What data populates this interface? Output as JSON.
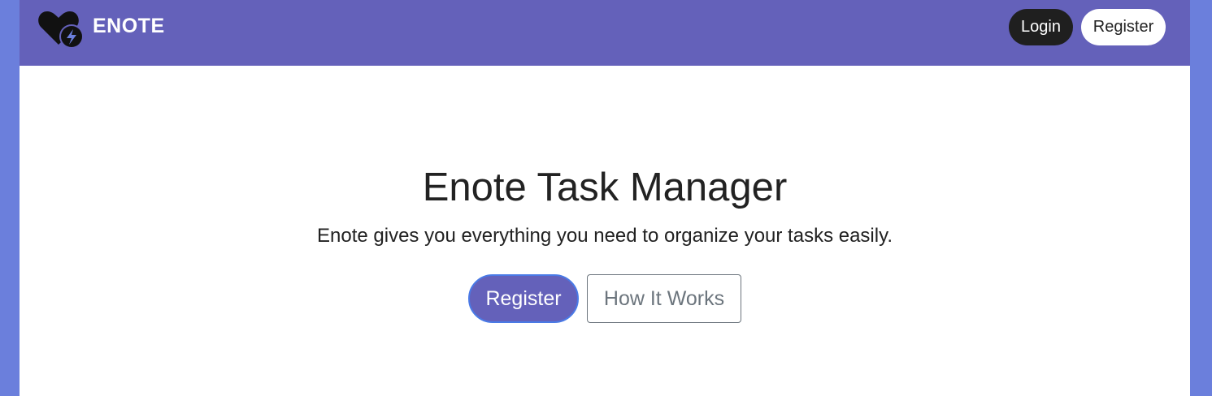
{
  "navbar": {
    "brand_name": "ENOTE",
    "login_label": "Login",
    "register_label": "Register"
  },
  "hero": {
    "title": "Enote Task Manager",
    "subtitle": "Enote gives you everything you need to organize your tasks easily.",
    "primary_button": "Register",
    "secondary_button": "How It Works"
  },
  "colors": {
    "navbar_bg": "#6461ba",
    "outer_bg": "#6b7fdc",
    "login_bg": "#1f1f1f",
    "primary_button_border": "#4a7ae6"
  },
  "icons": {
    "brand_logo": "heart-lightning-icon"
  }
}
